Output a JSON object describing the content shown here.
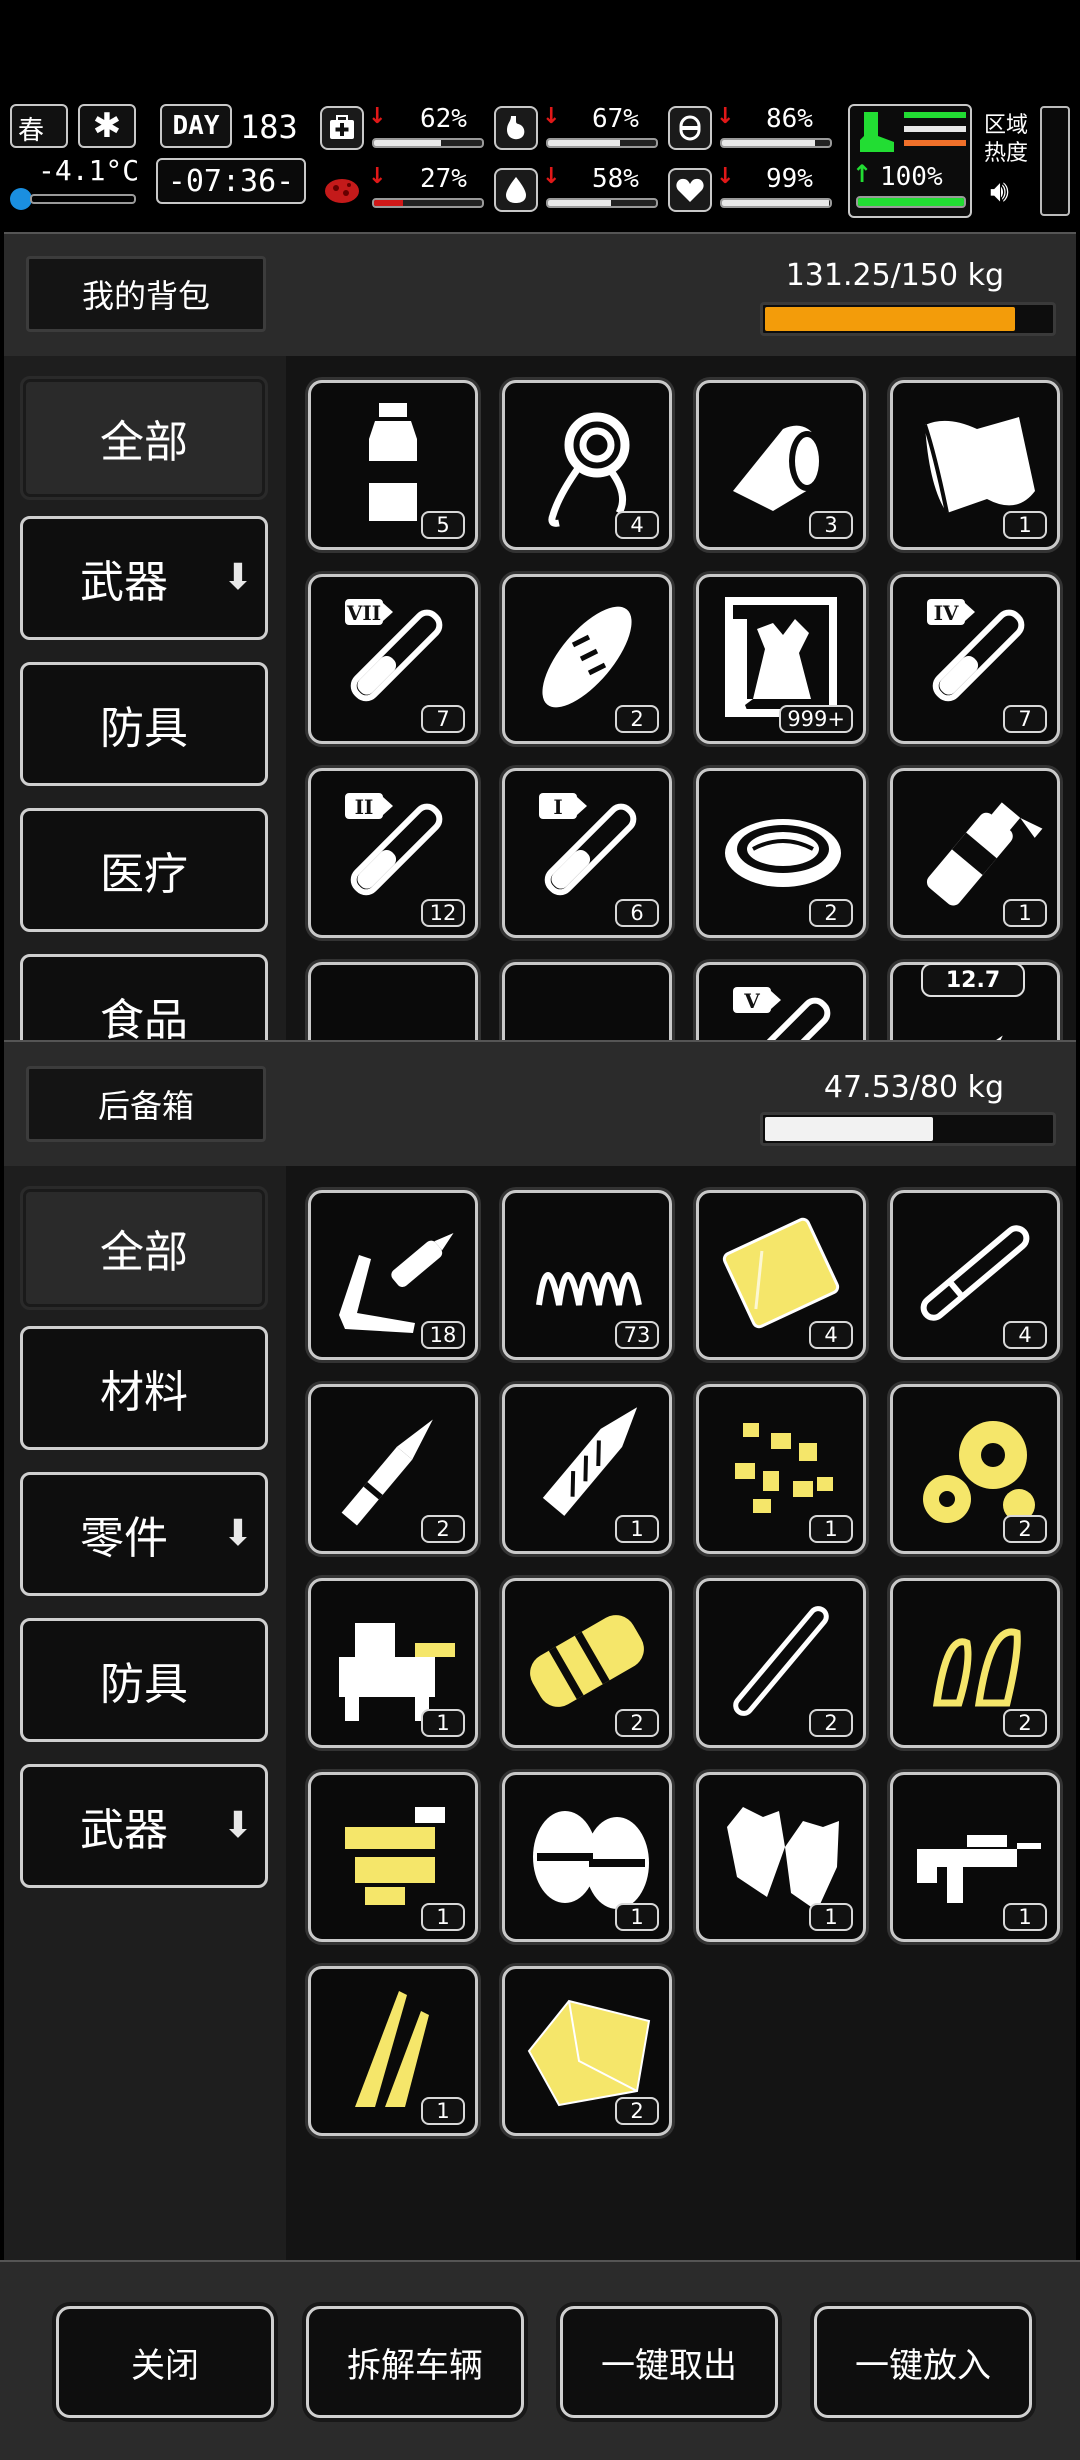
{
  "status": {
    "season": "春",
    "temperature": "-4.1°C",
    "day_label": "DAY",
    "day": "183",
    "time": "-07:36-",
    "stats": [
      {
        "name": "health",
        "icon": "medkit-icon",
        "value": "62%",
        "fill": 0.62,
        "trend": "down"
      },
      {
        "name": "hunger",
        "icon": "stomach-icon",
        "value": "67%",
        "fill": 0.67,
        "trend": "down"
      },
      {
        "name": "stamina",
        "icon": "pill-icon",
        "value": "86%",
        "fill": 0.86,
        "trend": "down"
      },
      {
        "name": "infection",
        "icon": "virus-icon",
        "value": "27%",
        "fill": 0.27,
        "trend": "down"
      },
      {
        "name": "thirst",
        "icon": "water-drop-icon",
        "value": "58%",
        "fill": 0.58,
        "trend": "down"
      },
      {
        "name": "mood",
        "icon": "heart-icon",
        "value": "99%",
        "fill": 0.99,
        "trend": "down"
      }
    ],
    "energy": {
      "value": "100%",
      "fill": 1.0,
      "trend": "up"
    },
    "zone_heat_label": "区域热度"
  },
  "backpack": {
    "title": "我的背包",
    "weight": "131.25/150 kg",
    "weight_fraction": 0.875,
    "bar_color": "#f39c0a",
    "categories": [
      {
        "label": "全部",
        "active": true,
        "arrow": false
      },
      {
        "label": "武器",
        "active": false,
        "arrow": true
      },
      {
        "label": "防具",
        "active": false,
        "arrow": false
      },
      {
        "label": "医疗",
        "active": false,
        "arrow": false
      },
      {
        "label": "食品",
        "active": false,
        "arrow": false
      }
    ],
    "items": [
      {
        "name": "water-bottle",
        "qty": "5"
      },
      {
        "name": "rope",
        "qty": "4"
      },
      {
        "name": "bandage-roll",
        "qty": "3"
      },
      {
        "name": "cloth",
        "qty": "1"
      },
      {
        "name": "test-tube-vii",
        "qty": "7"
      },
      {
        "name": "bread",
        "qty": "2"
      },
      {
        "name": "zombie-card",
        "qty": "999+"
      },
      {
        "name": "test-tube-iv",
        "qty": "7"
      },
      {
        "name": "test-tube-ii",
        "qty": "12"
      },
      {
        "name": "test-tube-i",
        "qty": "6"
      },
      {
        "name": "canned-food",
        "qty": "2"
      },
      {
        "name": "spray-bottle",
        "qty": "1"
      },
      {
        "name": "item-partial-1",
        "qty": ""
      },
      {
        "name": "item-partial-2",
        "qty": ""
      },
      {
        "name": "test-tube-v",
        "qty": ""
      },
      {
        "name": "ammo-12-7",
        "qty": "",
        "caliber": "12.7"
      }
    ]
  },
  "storage": {
    "title": "后备箱",
    "weight": "47.53/80 kg",
    "weight_fraction": 0.594,
    "bar_color": "#f2f2f2",
    "categories": [
      {
        "label": "全部",
        "active": true,
        "arrow": false
      },
      {
        "label": "材料",
        "active": false,
        "arrow": false
      },
      {
        "label": "零件",
        "active": false,
        "arrow": true
      },
      {
        "label": "防具",
        "active": false,
        "arrow": false
      },
      {
        "label": "武器",
        "active": false,
        "arrow": true
      }
    ],
    "items": [
      {
        "name": "soldering-iron",
        "qty": "18"
      },
      {
        "name": "spring",
        "qty": "73"
      },
      {
        "name": "metal-plate",
        "qty": "4"
      },
      {
        "name": "pipe",
        "qty": "4"
      },
      {
        "name": "bullet",
        "qty": "2"
      },
      {
        "name": "blade-tip",
        "qty": "1"
      },
      {
        "name": "scrap-pieces",
        "qty": "1"
      },
      {
        "name": "gears",
        "qty": "2"
      },
      {
        "name": "vise",
        "qty": "1"
      },
      {
        "name": "suppressor",
        "qty": "2"
      },
      {
        "name": "rod",
        "qty": "2"
      },
      {
        "name": "clips",
        "qty": "2"
      },
      {
        "name": "rifle-parts",
        "qty": "1"
      },
      {
        "name": "knee-pads",
        "qty": "1"
      },
      {
        "name": "gloves",
        "qty": "1"
      },
      {
        "name": "assault-rifle",
        "qty": "1"
      },
      {
        "name": "knife-blades",
        "qty": "1"
      },
      {
        "name": "cloth-sheet",
        "qty": "2"
      }
    ]
  },
  "actions": {
    "close": "关闭",
    "dismantle": "拆解车辆",
    "take_all": "一键取出",
    "put_all": "一键放入"
  },
  "colors": {
    "item_white": "#ffffff",
    "item_yellow": "#f5e66a"
  }
}
